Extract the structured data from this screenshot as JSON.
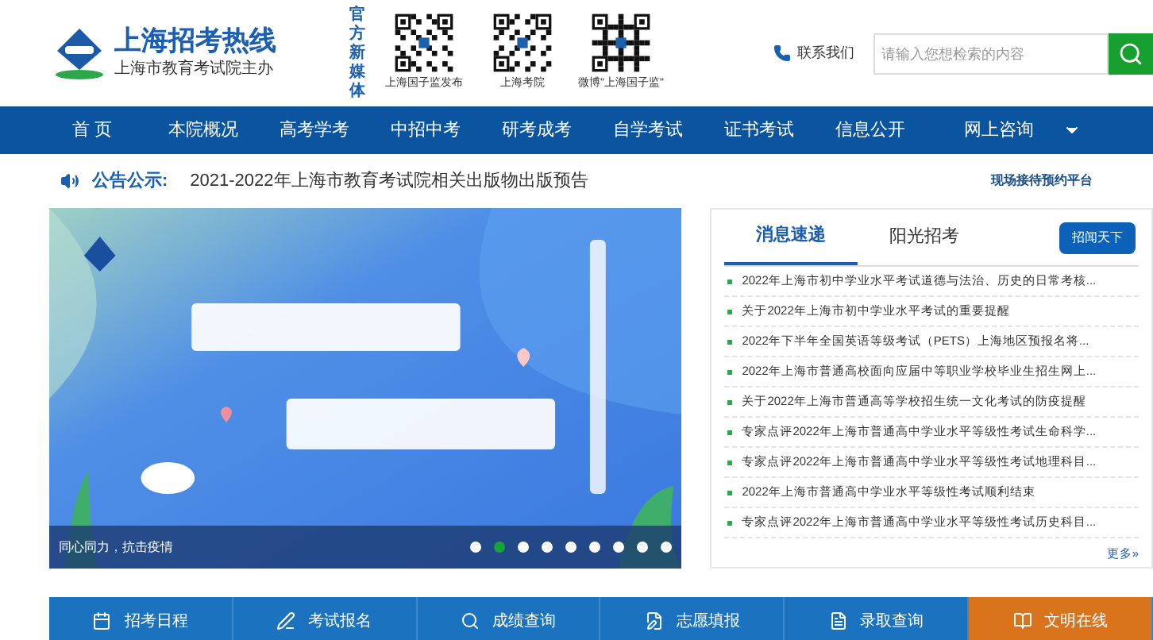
{
  "header": {
    "site_title": "上海招考热线",
    "site_subtitle": "上海市教育考试院主办",
    "media_label": "官方新媒体",
    "qr_codes": [
      {
        "caption": "上海国子监发布"
      },
      {
        "caption": "上海考院"
      },
      {
        "caption": "微博\"上海国子监\""
      }
    ],
    "contact": "联系我们",
    "search": {
      "placeholder": "请输入您想检索的内容"
    }
  },
  "nav": [
    {
      "label": "首 页",
      "selected": false
    },
    {
      "label": "本院概况",
      "selected": false
    },
    {
      "label": "高考学考",
      "selected": false
    },
    {
      "label": "中招中考",
      "selected": false
    },
    {
      "label": "研考成考",
      "selected": false
    },
    {
      "label": "自学考试",
      "selected": false
    },
    {
      "label": "证书考试",
      "selected": false
    },
    {
      "label": "信息公开",
      "selected": false
    },
    {
      "label": "网上咨询",
      "selected": false
    }
  ],
  "notice": {
    "label": "公告公示:",
    "text": "2021-2022年上海市教育考试院相关出版物出版预告",
    "link": "现场接待预约平台"
  },
  "banner": {
    "kind": "picture",
    "caption": "同心同力，抗击疫情",
    "dots": [
      {
        "selected": false
      },
      {
        "selected": true
      },
      {
        "selected": false
      },
      {
        "selected": false
      },
      {
        "selected": false
      },
      {
        "selected": false
      },
      {
        "selected": false
      },
      {
        "selected": false
      },
      {
        "selected": false
      }
    ]
  },
  "news": {
    "tabs": [
      {
        "label": "消息速递",
        "selected": true
      },
      {
        "label": "阳光招考",
        "selected": false
      }
    ],
    "button": "招闻天下",
    "items": [
      "2022年上海市初中学业水平考试道德与法治、历史的日常考核...",
      "关于2022年上海市初中学业水平考试的重要提醒",
      "2022年下半年全国英语等级考试（PETS）上海地区预报名将...",
      "2022年上海市普通高校面向应届中等职业学校毕业生招生网上...",
      "关于2022年上海市普通高等学校招生统一文化考试的防疫提醒",
      "专家点评2022年上海市普通高中学业水平等级性考试生命科学...",
      "专家点评2022年上海市普通高中学业水平等级性考试地理科目...",
      "2022年上海市普通高中学业水平等级性考试顺利结束",
      "专家点评2022年上海市普通高中学业水平等级性考试历史科目..."
    ],
    "more": "更多»"
  },
  "quick_links": [
    {
      "label": "招考日程",
      "kind": "calendar"
    },
    {
      "label": "考试报名",
      "kind": "pen"
    },
    {
      "label": "成绩查询",
      "kind": "search"
    },
    {
      "label": "志愿填报",
      "kind": "form"
    },
    {
      "label": "录取查询",
      "kind": "doc"
    },
    {
      "label": "文明在线",
      "kind": "book"
    }
  ]
}
